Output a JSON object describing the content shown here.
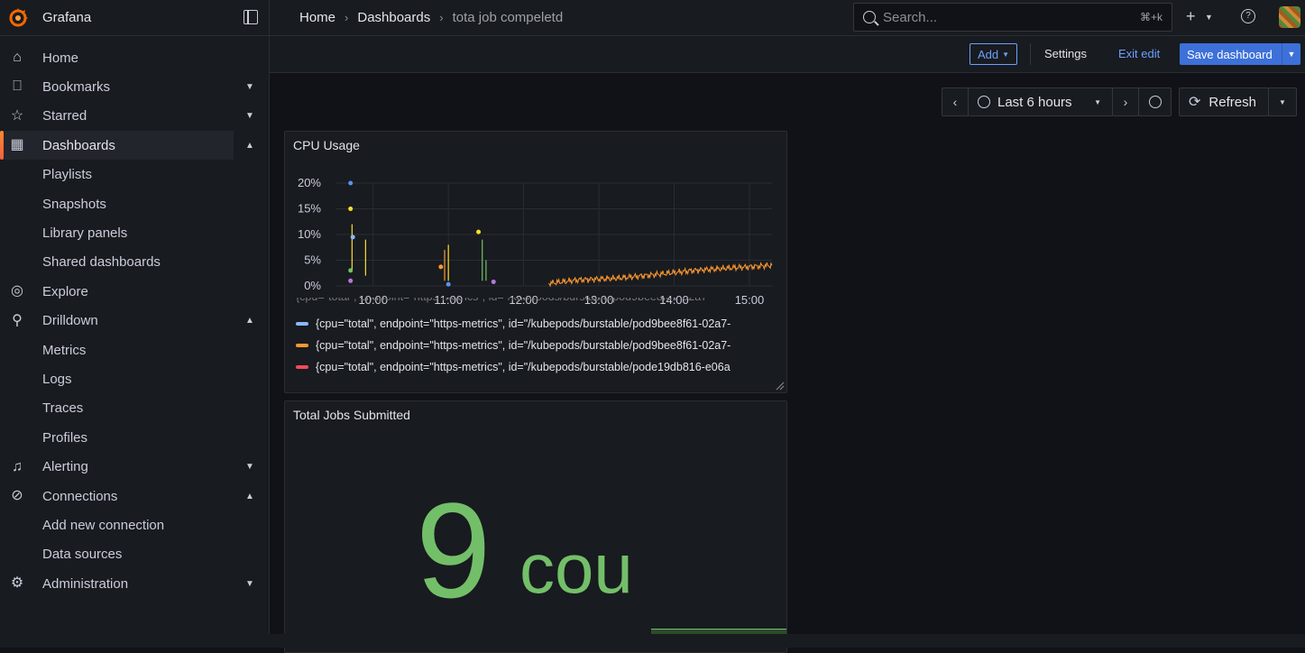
{
  "app": {
    "name": "Grafana"
  },
  "breadcrumb": {
    "home": "Home",
    "dashboards": "Dashboards",
    "current": "tota job compeletd"
  },
  "search": {
    "placeholder": "Search...",
    "shortcut": "⌘+k"
  },
  "sidebar": {
    "items": [
      {
        "label": "Home",
        "icon": "home-icon"
      },
      {
        "label": "Bookmarks",
        "icon": "bookmark-icon",
        "chevron": "down"
      },
      {
        "label": "Starred",
        "icon": "star-icon",
        "chevron": "down"
      },
      {
        "label": "Dashboards",
        "icon": "apps-icon",
        "chevron": "up",
        "active": true
      },
      {
        "label": "Playlists",
        "child": true
      },
      {
        "label": "Snapshots",
        "child": true
      },
      {
        "label": "Library panels",
        "child": true
      },
      {
        "label": "Shared dashboards",
        "child": true
      },
      {
        "label": "Explore",
        "icon": "compass-icon"
      },
      {
        "label": "Drilldown",
        "icon": "microscope-icon",
        "chevron": "up"
      },
      {
        "label": "Metrics",
        "child": true
      },
      {
        "label": "Logs",
        "child": true
      },
      {
        "label": "Traces",
        "child": true
      },
      {
        "label": "Profiles",
        "child": true
      },
      {
        "label": "Alerting",
        "icon": "bell-icon",
        "chevron": "down"
      },
      {
        "label": "Connections",
        "icon": "connections-icon",
        "chevron": "up"
      },
      {
        "label": "Add new connection",
        "child": true
      },
      {
        "label": "Data sources",
        "child": true
      },
      {
        "label": "Administration",
        "icon": "cog-icon",
        "chevron": "down"
      }
    ]
  },
  "toolbar": {
    "add_label": "Add",
    "settings_label": "Settings",
    "exit_edit_label": "Exit edit",
    "save_label": "Save dashboard"
  },
  "time_controls": {
    "range_label": "Last 6 hours",
    "refresh_label": "Refresh"
  },
  "panels": {
    "cpu": {
      "title": "CPU Usage",
      "legend": [
        {
          "text": "{cpu=\"total\", endpoint=\"https-metrics\", id=\"/kubepods/burstable/pod9bee8f61-02a7-",
          "color": "#8ab8ff"
        },
        {
          "text": "{cpu=\"total\", endpoint=\"https-metrics\", id=\"/kubepods/burstable/pod9bee8f61-02a7-",
          "color": "#ff9830"
        },
        {
          "text": "{cpu=\"total\", endpoint=\"https-metrics\", id=\"/kubepods/burstable/pode19db816-e06a",
          "color": "#f2495c"
        }
      ]
    },
    "jobs": {
      "title": "Total Jobs Submitted",
      "value": "9",
      "unit": "cou",
      "color": "#73bf69"
    }
  },
  "chart_data": {
    "type": "line",
    "title": "CPU Usage",
    "y_ticks": [
      "0%",
      "5%",
      "10%",
      "15%",
      "20%"
    ],
    "x_ticks": [
      "10:00",
      "11:00",
      "12:00",
      "13:00",
      "14:00",
      "15:00"
    ],
    "ylim": [
      0,
      20
    ],
    "grid": true,
    "series": [
      {
        "color": "#ff9830",
        "x": [
          12.33,
          12.75,
          13.25,
          13.75,
          14.25,
          14.75,
          15.3
        ],
        "y": [
          0.5,
          1.2,
          1.5,
          2.2,
          3.0,
          3.5,
          4.0
        ]
      }
    ],
    "points": [
      {
        "color": "#5794f2",
        "x": 9.7,
        "y": 20
      },
      {
        "color": "#fade2a",
        "x": 9.7,
        "y": 15
      },
      {
        "color": "#8ab8ff",
        "x": 9.73,
        "y": 9.5
      },
      {
        "color": "#73bf69",
        "x": 9.7,
        "y": 3
      },
      {
        "color": "#b877d9",
        "x": 9.7,
        "y": 1
      },
      {
        "color": "#ff9830",
        "x": 10.9,
        "y": 3.7
      },
      {
        "color": "#5794f2",
        "x": 11.0,
        "y": 0.3
      },
      {
        "color": "#fade2a",
        "x": 11.4,
        "y": 10.5
      },
      {
        "color": "#b877d9",
        "x": 11.6,
        "y": 0.8
      }
    ]
  }
}
